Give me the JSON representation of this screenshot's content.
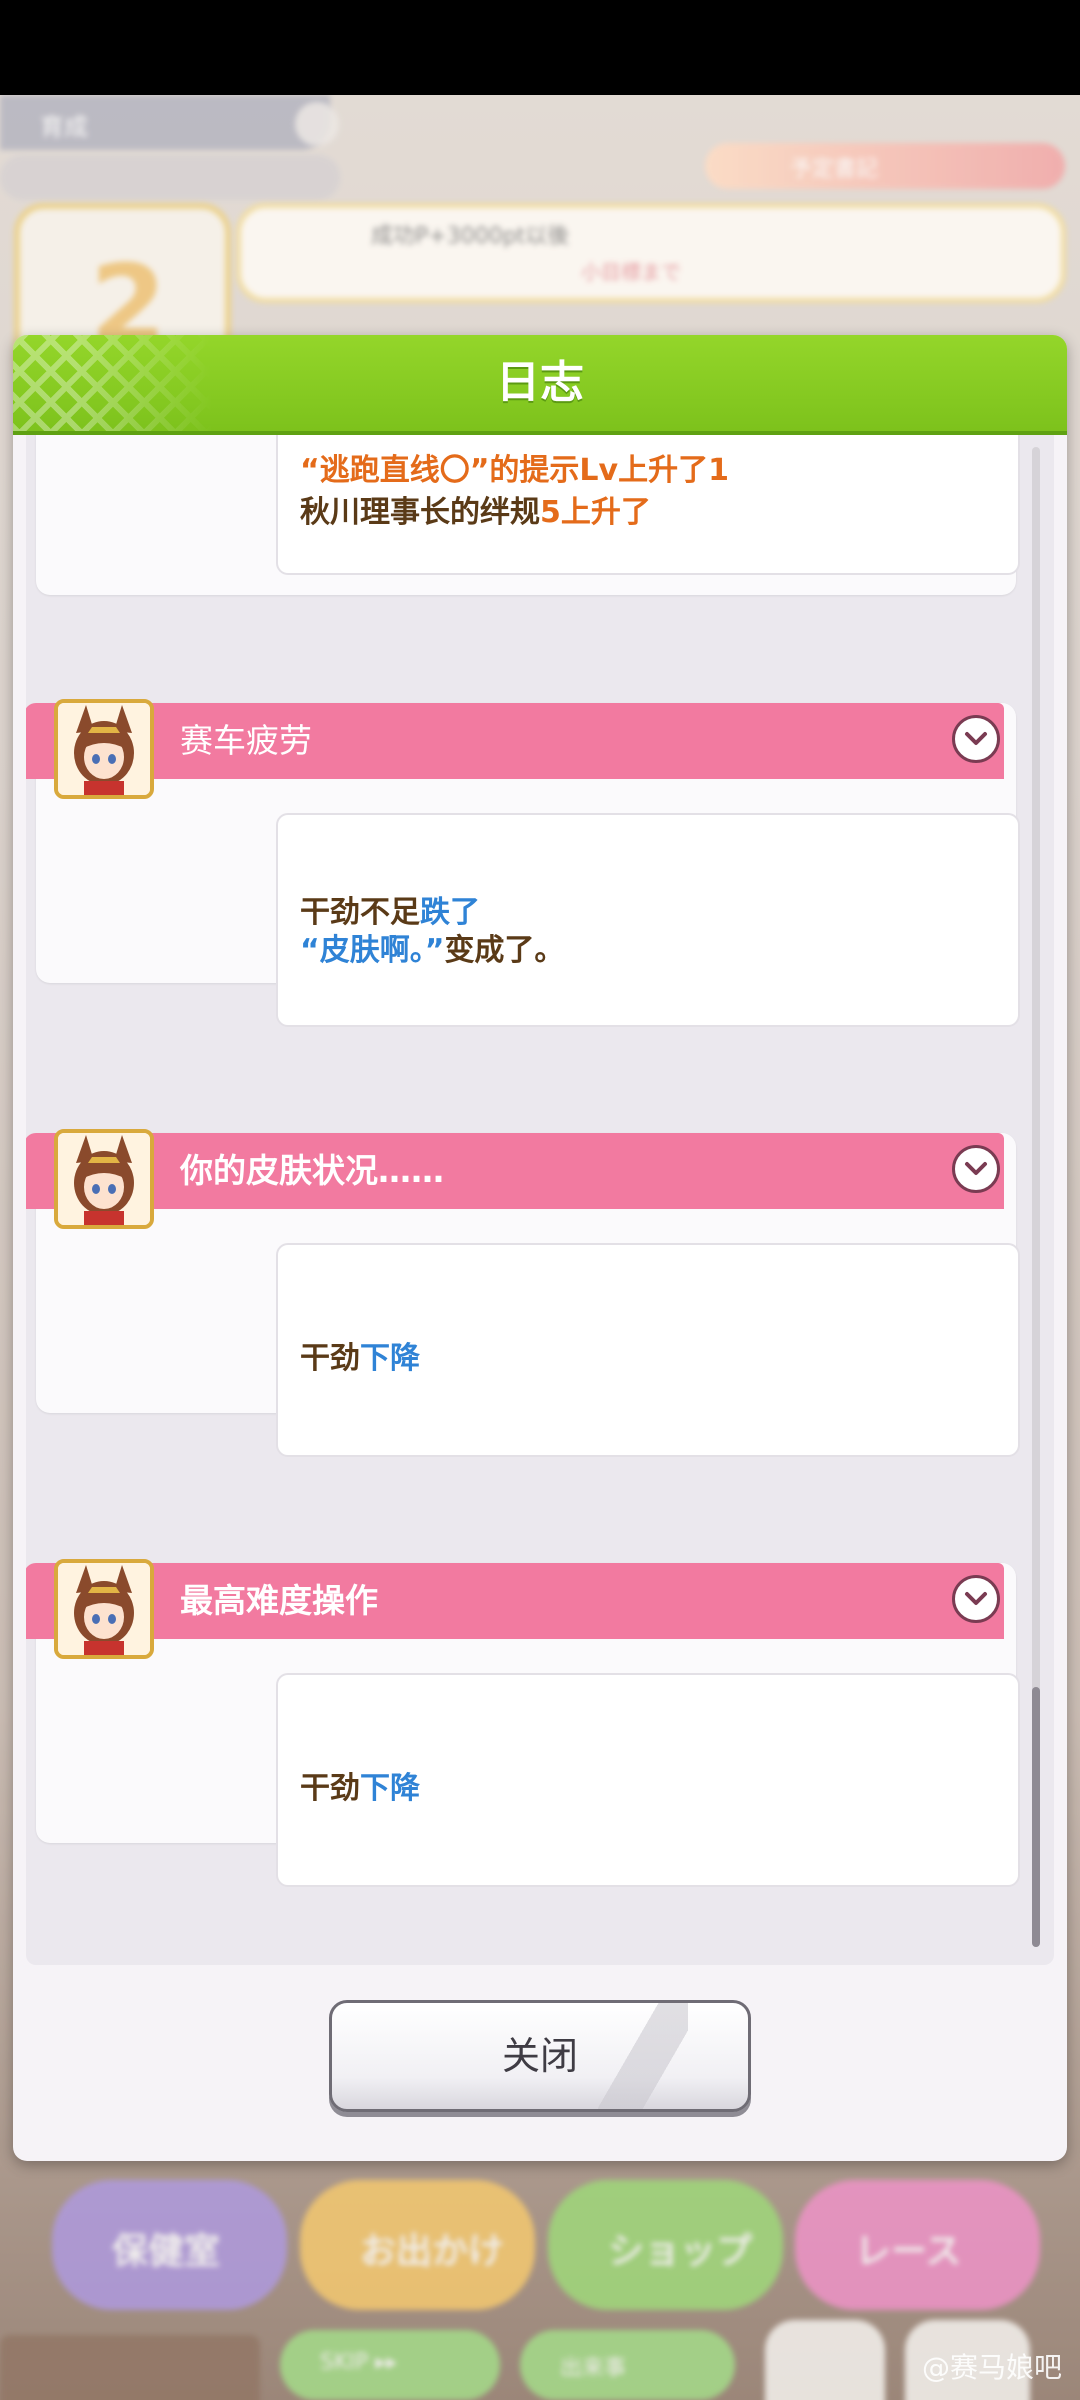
{
  "background": {
    "top_left_label": "育成",
    "calendar_number": "2",
    "tip_text": "成功P+3000pt以後",
    "tip_sub": "小目標まで",
    "event_label": "予定書記",
    "buttons": [
      "保健室",
      "お出かけ",
      "ショップ",
      "レース"
    ],
    "skip_label": "SKIP ▸▸",
    "skip2_label": "出来事",
    "watermark": "@赛马娘吧"
  },
  "dialog": {
    "title": "日志",
    "close_label": "关闭",
    "entries": [
      {
        "lines": [
          {
            "parts": [
              {
                "t": "“逃跑直线〇”的提示Lv上升了1",
                "c": "o"
              }
            ]
          },
          {
            "parts": [
              {
                "t": "秋川理事长的绊规",
                "c": ""
              },
              {
                "t": "5上升了",
                "c": "o"
              }
            ]
          }
        ]
      },
      {
        "title": "赛车疲劳",
        "lines": [
          {
            "parts": [
              {
                "t": "干劲不足",
                "c": ""
              },
              {
                "t": "跌了",
                "c": "b"
              }
            ]
          },
          {
            "parts": [
              {
                "t": "“皮肤啊。”",
                "c": "b"
              },
              {
                "t": "变成了。",
                "c": ""
              }
            ]
          }
        ]
      },
      {
        "title": "你的皮肤状况……",
        "lines": [
          {
            "parts": [
              {
                "t": "干劲",
                "c": ""
              },
              {
                "t": "下降",
                "c": "b"
              }
            ]
          }
        ]
      },
      {
        "title": "最高难度操作",
        "lines": [
          {
            "parts": [
              {
                "t": "干劲",
                "c": ""
              },
              {
                "t": "下降",
                "c": "b"
              }
            ]
          }
        ]
      }
    ]
  },
  "colors": {
    "header_green": "#7dc21c",
    "entry_pink": "#f27aa0",
    "highlight_orange": "#e46b1a",
    "highlight_blue": "#2f83d6",
    "text_brown": "#5a3a17"
  }
}
